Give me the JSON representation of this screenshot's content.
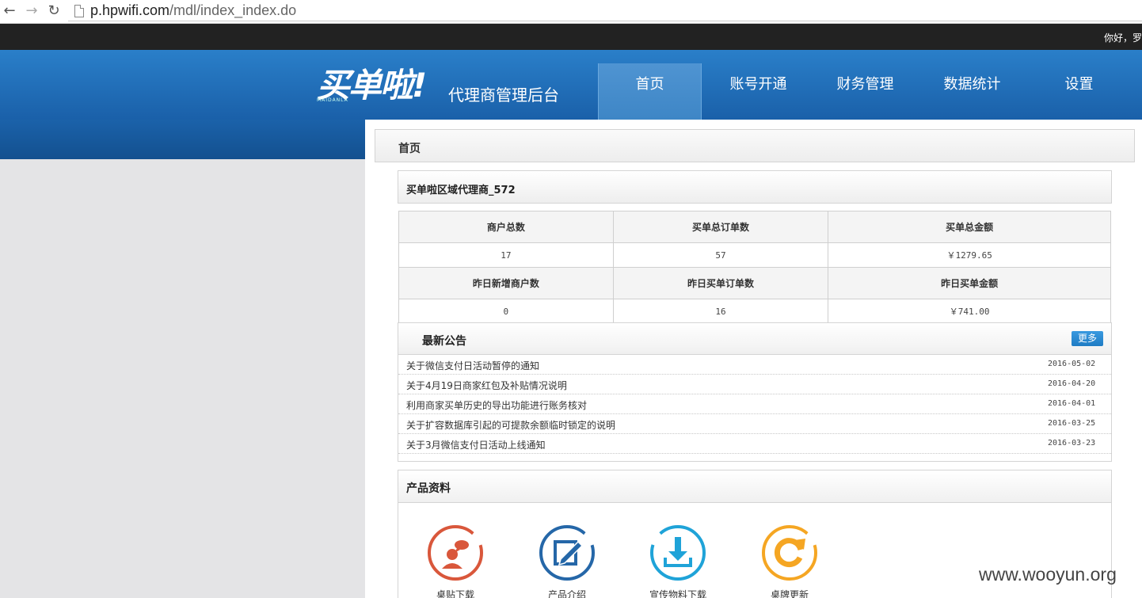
{
  "browser": {
    "url_host": "p.hpwifi.com",
    "url_path": "/mdl/index_index.do"
  },
  "topbar": {
    "greeting": "你好，罗"
  },
  "header": {
    "logo": "买单啦!",
    "logo_sub": "MAIDANLA",
    "tagline": "代理商管理后台",
    "nav": [
      {
        "label": "首页",
        "active": true
      },
      {
        "label": "账号开通"
      },
      {
        "label": "财务管理"
      },
      {
        "label": "数据统计"
      },
      {
        "label": "设置"
      }
    ]
  },
  "crumb": {
    "title": "首页"
  },
  "agent": {
    "name": "买单啦区域代理商_572"
  },
  "stats": {
    "row1_headers": [
      "商户总数",
      "买单总订单数",
      "买单总金额"
    ],
    "row1_values": [
      "17",
      "57",
      "￥1279.65"
    ],
    "row2_headers": [
      "昨日新增商户数",
      "昨日买单订单数",
      "昨日买单金额"
    ],
    "row2_values": [
      "0",
      "16",
      "￥741.00"
    ]
  },
  "notice": {
    "title": "最新公告",
    "more": "更多",
    "items": [
      {
        "title": "关于微信支付日活动暂停的通知",
        "date": "2016-05-02"
      },
      {
        "title": "关于4月19日商家红包及补贴情况说明",
        "date": "2016-04-20"
      },
      {
        "title": "利用商家买单历史的导出功能进行账务核对",
        "date": "2016-04-01"
      },
      {
        "title": "关于扩容数据库引起的可提款余额临时锁定的说明",
        "date": "2016-03-25"
      },
      {
        "title": "关于3月微信支付日活动上线通知",
        "date": "2016-03-23"
      }
    ]
  },
  "product": {
    "title": "产品资料",
    "items": [
      {
        "label": "桌贴下载",
        "icon": "person-chat-icon",
        "color": "#d9573b"
      },
      {
        "label": "产品介绍",
        "icon": "edit-icon",
        "color": "#2567a8"
      },
      {
        "label": "宣传物料下载",
        "icon": "download-icon",
        "color": "#1fa3d8"
      },
      {
        "label": "桌牌更新",
        "icon": "refresh-icon",
        "color": "#f5a623"
      }
    ]
  },
  "watermark": "www.wooyun.org"
}
